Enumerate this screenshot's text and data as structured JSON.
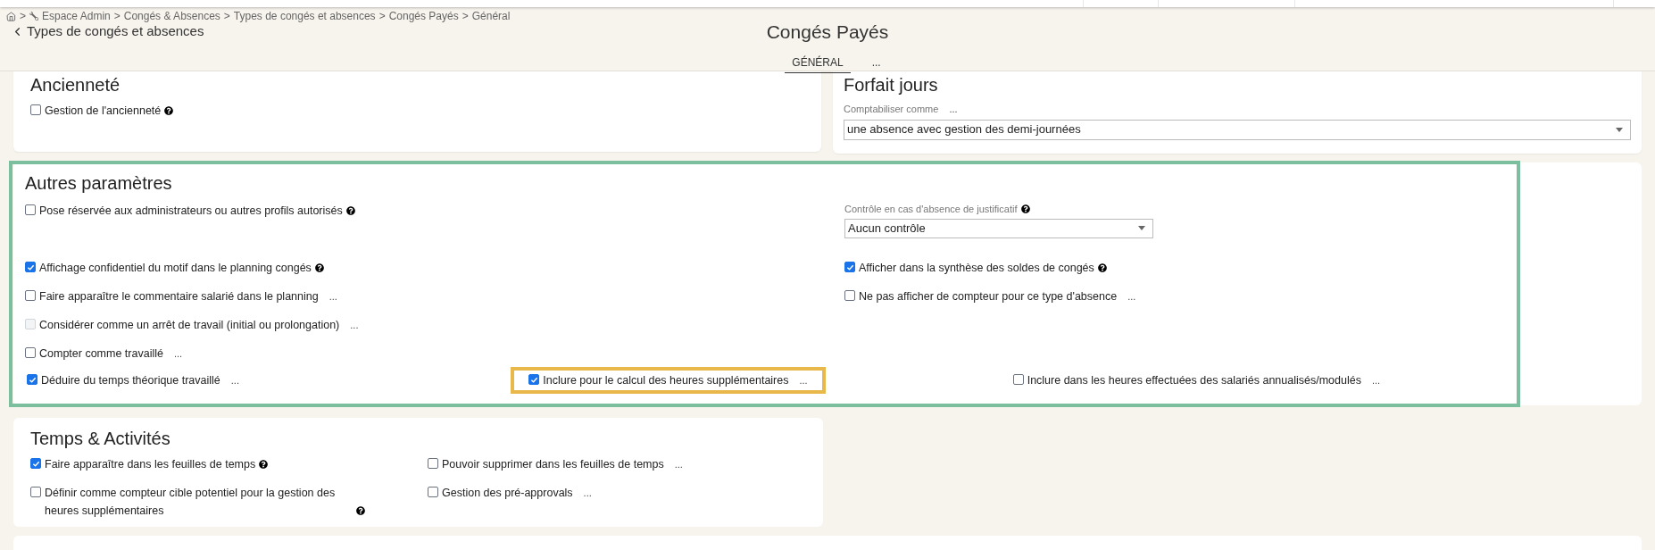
{
  "breadcrumb": {
    "separator": ">",
    "items": [
      {
        "kind": "home"
      },
      {
        "kind": "admin",
        "label": "Espace Admin"
      },
      {
        "kind": "text",
        "label": "Congés & Absences"
      },
      {
        "kind": "text",
        "label": "Types de congés et absences"
      },
      {
        "kind": "text",
        "label": "Congés Payés"
      },
      {
        "kind": "text",
        "label": "Général"
      }
    ]
  },
  "back_link": "Types de congés et absences",
  "title": "Congés Payés",
  "tabs": [
    {
      "label": "GÉNÉRAL",
      "selected": true
    },
    {
      "label": "...",
      "selected": false
    }
  ],
  "anciennete": {
    "title": "Ancienneté",
    "options": [
      {
        "label": "Gestion de l'ancienneté",
        "checked": false,
        "disabled": false,
        "help": true
      }
    ]
  },
  "forfait_jours": {
    "title": "Forfait jours",
    "field": {
      "label": "Comptabiliser comme",
      "more": "...",
      "value": "une absence avec gestion des demi-journées"
    }
  },
  "autres_parametres": {
    "title": "Autres paramètres",
    "highlighted": true,
    "left_options": [
      {
        "label": "Pose réservée aux administrateurs ou autres profils autorisés",
        "checked": false,
        "disabled": false,
        "help": true
      },
      {
        "label": "Affichage confidentiel du motif dans le planning congés",
        "checked": true,
        "disabled": false,
        "help": true
      },
      {
        "label": "Faire apparaître le commentaire salarié dans le planning",
        "checked": false,
        "disabled": false,
        "help": false,
        "more": "..."
      },
      {
        "label": "Considérer comme un arrêt de travail (initial ou prolongation)",
        "checked": false,
        "disabled": true,
        "help": false,
        "more": "..."
      },
      {
        "label": "Compter comme travaillé",
        "checked": false,
        "disabled": false,
        "help": false,
        "more": "..."
      }
    ],
    "control_field": {
      "label": "Contrôle en cas d'absence de justificatif",
      "help": true,
      "value": "Aucun contrôle"
    },
    "right_options": [
      {
        "label": "Afficher dans la synthèse des soldes de congés",
        "checked": true,
        "disabled": false,
        "help": true
      },
      {
        "label": "Ne pas afficher de compteur pour ce type d'absence",
        "checked": false,
        "disabled": false,
        "help": false,
        "more": "..."
      }
    ],
    "bottom_options": [
      {
        "label": "Déduire du temps théorique travaillé",
        "checked": true,
        "disabled": false,
        "help": false,
        "more": "...",
        "highlighted": false
      },
      {
        "label": "Inclure pour le calcul des heures supplémentaires",
        "checked": true,
        "disabled": false,
        "help": false,
        "more": "...",
        "highlighted": true
      },
      {
        "label": "Inclure dans les heures effectuées des salariés annualisés/modulés",
        "checked": false,
        "disabled": false,
        "help": false,
        "more": "...",
        "highlighted": false
      }
    ]
  },
  "temps_activites": {
    "title": "Temps & Activités",
    "options": [
      {
        "label": "Faire apparaître dans les feuilles de temps",
        "checked": true,
        "disabled": false,
        "help": true
      },
      {
        "label": "Pouvoir supprimer dans les feuilles de temps",
        "checked": false,
        "disabled": false,
        "help": false,
        "more": "..."
      },
      {
        "label": "Définir comme compteur cible potentiel pour la gestion des heures supplémentaires",
        "checked": false,
        "disabled": false,
        "help": true
      },
      {
        "label": "Gestion des pré-approvals",
        "checked": false,
        "disabled": false,
        "help": false,
        "more": "..."
      }
    ]
  }
}
